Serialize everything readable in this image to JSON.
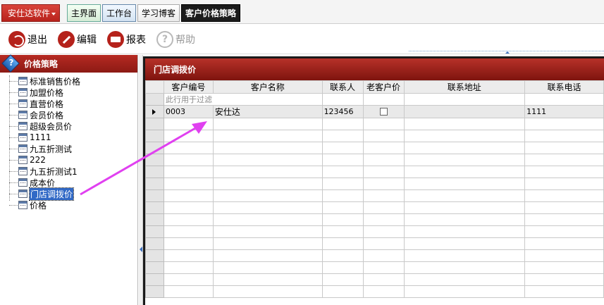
{
  "app": {
    "menu_label": "安仕达软件"
  },
  "tabs": [
    {
      "label": "主界面"
    },
    {
      "label": "工作台"
    },
    {
      "label": "学习博客"
    },
    {
      "label": "客户价格策略",
      "active": true
    }
  ],
  "toolbar": {
    "exit_label": "退出",
    "edit_label": "编辑",
    "report_label": "报表",
    "help_label": "帮助"
  },
  "sidebar": {
    "title": "价格策略",
    "items": [
      {
        "label": "标准销售价格"
      },
      {
        "label": "加盟价格"
      },
      {
        "label": "直营价格"
      },
      {
        "label": "会员价格"
      },
      {
        "label": "超级会员价"
      },
      {
        "label": "1111"
      },
      {
        "label": "九五折测试"
      },
      {
        "label": "222"
      },
      {
        "label": "九五折测试1"
      },
      {
        "label": "成本价"
      },
      {
        "label": "门店调拨价",
        "selected": true
      },
      {
        "label": "价格"
      }
    ]
  },
  "grid": {
    "title": "门店调拨价",
    "columns": [
      "客户编号",
      "客户名称",
      "联系人",
      "老客户价",
      "联系地址",
      "联系电话"
    ],
    "filter_hint": "此行用于过滤",
    "rows": [
      {
        "code": "0003",
        "name": "安仕达",
        "contact": "123456",
        "old_price": false,
        "address": "",
        "phone": "1111"
      }
    ]
  },
  "colors": {
    "brand_red": "#b5221b",
    "selection_blue": "#3169c6",
    "annotation_magenta": "#e040f0"
  }
}
